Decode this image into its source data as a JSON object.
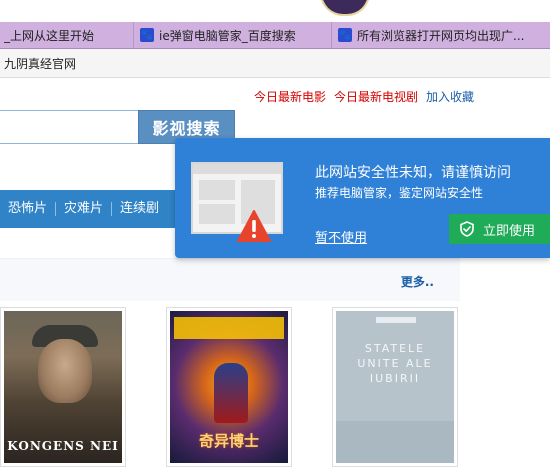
{
  "tabs": [
    {
      "label": "_上网从这里开始",
      "icon": ""
    },
    {
      "label": "ie弹窗电脑管家_百度搜索",
      "icon": "paw-icon"
    },
    {
      "label": "所有浏览器打开网页均出现广...",
      "icon": "paw-icon"
    }
  ],
  "bookmarks": {
    "item1": "九阴真经官网"
  },
  "page": {
    "top_links": {
      "movies": "今日最新电影",
      "tv": "今日最新电视剧",
      "favorite": "加入收藏"
    },
    "search": {
      "placeholder": "",
      "button": "影视搜索"
    },
    "categories": [
      "恐怖片",
      "灾难片",
      "连续剧"
    ],
    "more": "更多..",
    "posters": [
      {
        "title": "KONGENS NEI"
      },
      {
        "banner": "",
        "title": "奇异博士"
      },
      {
        "title": "STATELE\nUNITE ALE\nIUBIRII"
      }
    ]
  },
  "popup": {
    "headline": "此网站安全性未知，请谨慎访问",
    "subline": "推荐电脑管家，鉴定网站安全性",
    "dismiss": "暂不使用",
    "use_now": "立即使用",
    "colors": {
      "background": "#2f80d7",
      "button": "#1fab57",
      "warning": "#e8442c"
    }
  }
}
